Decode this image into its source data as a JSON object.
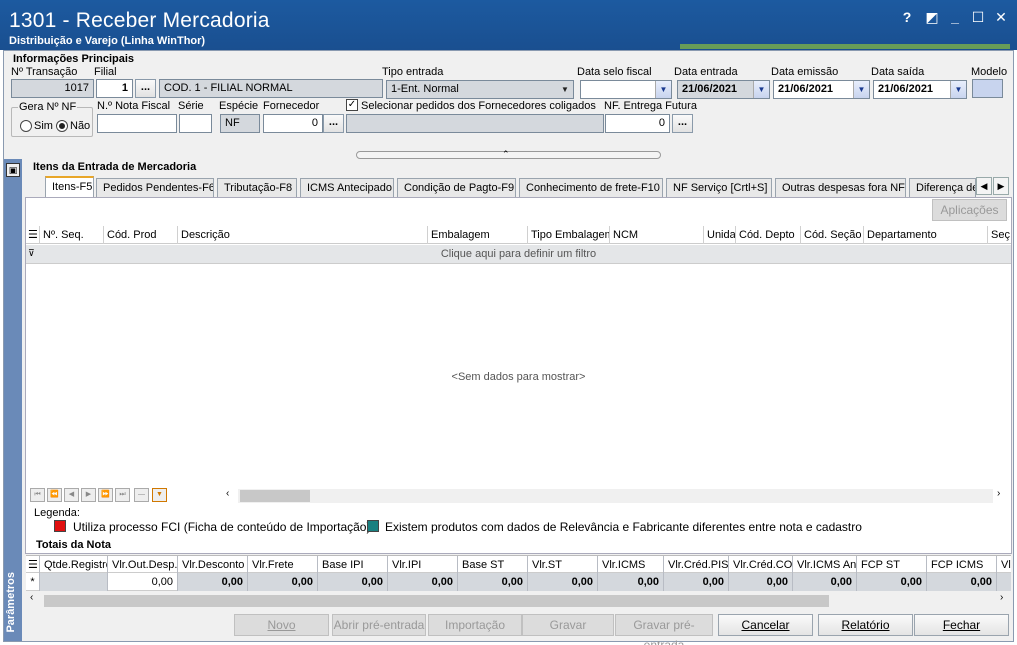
{
  "window": {
    "title": "1301 - Receber Mercadoria",
    "subtitle": "Distribuição e Varejo (Linha WinThor)",
    "help": "?",
    "minimize": "_",
    "maximize": "☐",
    "close": "✕"
  },
  "main_info": {
    "section_title": "Informações Principais",
    "transacao_label": "Nº Transação",
    "transacao_value": "1017",
    "filial_label": "Filial",
    "filial_value": "1",
    "filial_name": "COD. 1 - FILIAL NORMAL",
    "tipo_entrada_label": "Tipo entrada",
    "tipo_entrada_value": "1-Ent. Normal",
    "data_selo_label": "Data selo fiscal",
    "data_selo_value": "",
    "data_entrada_label": "Data entrada",
    "data_entrada_value": "21/06/2021",
    "data_emissao_label": "Data emissão",
    "data_emissao_value": "21/06/2021",
    "data_saida_label": "Data saída",
    "data_saida_value": "21/06/2021",
    "modelo_label": "Modelo",
    "gera_nf_label": "Gera Nº NF",
    "sim_label": "Sim",
    "nao_label": "Não",
    "nota_fiscal_label": "N.º Nota Fiscal",
    "serie_label": "Série",
    "especie_label": "Espécie",
    "especie_value": "NF",
    "fornecedor_label": "Fornecedor",
    "fornecedor_value": "0",
    "coligados_label": "Selecionar pedidos dos Fornecedores coligados",
    "nf_entrega_label": "NF. Entrega Futura",
    "nf_entrega_value": "0",
    "dots": "..."
  },
  "items_section": {
    "title": "Itens da Entrada de Mercadoria",
    "tabs": [
      "Itens-F5",
      "Pedidos Pendentes-F6",
      "Tributação-F8",
      "ICMS Antecipado",
      "Condição de Pagto-F9",
      "Conhecimento de frete-F10",
      "NF Serviço [Crtl+S]",
      "Outras despesas fora NF",
      "Diferença de"
    ],
    "aplicacoes_button": "Aplicações",
    "columns": [
      "Nº. Seq.",
      "Cód. Prod",
      "Descrição",
      "Embalagem",
      "Tipo Embalagem",
      "NCM",
      "Unida",
      "Cód. Depto",
      "Cód. Seção",
      "Departamento",
      "Seç"
    ],
    "filter_text": "Clique aqui para definir um filtro",
    "empty_text": "<Sem dados para mostrar>"
  },
  "legend": {
    "title": "Legenda:",
    "item1": "Utiliza processo FCI (Ficha de conteúdo de Importação)",
    "item1_color": "#e01010",
    "item2": "Existem produtos com dados de Relevância e Fabricante diferentes entre nota e cadastro",
    "item2_color": "#1a8080"
  },
  "totals": {
    "title": "Totais da Nota",
    "columns": [
      "Qtde.Registro",
      "Vlr.Out.Desp.",
      "Vlr.Desconto",
      "Vlr.Frete",
      "Base IPI",
      "Vlr.IPI",
      "Base ST",
      "Vlr.ST",
      "Vlr.ICMS",
      "Vlr.Créd.PIS",
      "Vlr.Créd.CO",
      "Vlr.ICMS An",
      "FCP ST",
      "FCP ICMS",
      "Vl"
    ],
    "row_marker": "*",
    "row": [
      "",
      "0,00",
      "0,00",
      "0,00",
      "0,00",
      "0,00",
      "0,00",
      "0,00",
      "0,00",
      "0,00",
      "0,00",
      "0,00",
      "0,00",
      "0,00",
      ""
    ]
  },
  "sidebar": {
    "label": "Parâmetros"
  },
  "footer": {
    "novo": "Novo",
    "abrir_pre": "Abrir pré-entrada",
    "importacao": "Importação",
    "gravar": "Gravar",
    "gravar_pre": "Gravar pré-entrada",
    "cancelar": "Cancelar",
    "relatorio": "Relatório",
    "fechar": "Fechar"
  }
}
